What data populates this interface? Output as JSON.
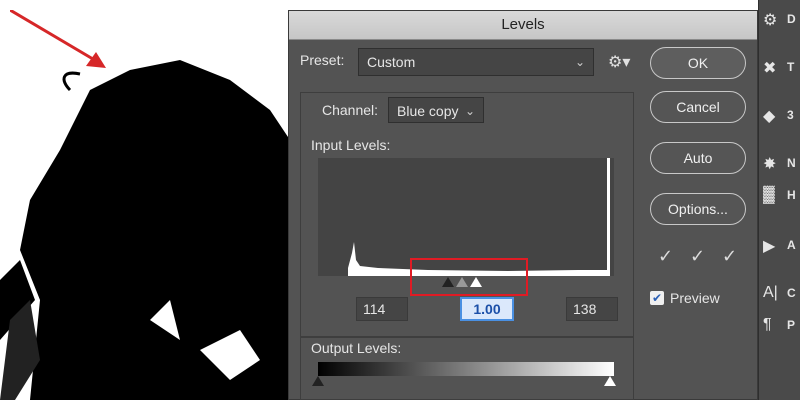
{
  "dialog": {
    "title": "Levels",
    "preset_label": "Preset:",
    "preset_value": "Custom",
    "channel_label": "Channel:",
    "channel_value": "Blue copy",
    "input_levels_label": "Input Levels:",
    "input_black": "114",
    "input_gamma": "1.00",
    "input_white": "138",
    "output_levels_label": "Output Levels:",
    "preview_label": "Preview",
    "preview_checked": true
  },
  "buttons": {
    "ok": "OK",
    "cancel": "Cancel",
    "auto": "Auto",
    "options": "Options..."
  },
  "right_panel": {
    "items": [
      {
        "icon": "layers-icon",
        "text": "D"
      },
      {
        "icon": "tools-icon",
        "text": "T"
      },
      {
        "icon": "3d-icon",
        "text": "3"
      },
      {
        "icon": "navigator-icon",
        "text": "N"
      },
      {
        "icon": "histogram-icon",
        "text": "H"
      },
      {
        "icon": "actions-icon",
        "text": "A"
      },
      {
        "icon": "character-icon",
        "text": "C"
      },
      {
        "icon": "paragraph-icon",
        "text": "P"
      }
    ]
  },
  "colors": {
    "dialog_bg": "#535353",
    "highlight_red": "#e01b24",
    "active_field": "#4a90e2"
  }
}
